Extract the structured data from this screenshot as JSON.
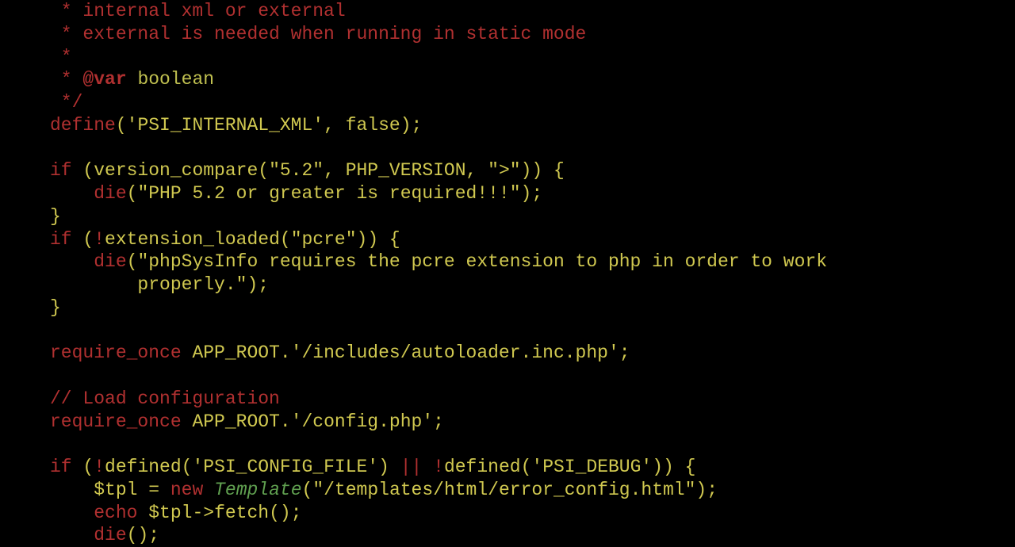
{
  "code": {
    "comment": {
      "l1": " * internal xml or external",
      "l2": " * external is needed when running in static mode",
      "l3": " *",
      "l4_prefix": " * ",
      "l4_tag": "@var",
      "l4_type": " boolean",
      "l5": " */"
    },
    "define": {
      "kw": "define",
      "openParen": "(",
      "str": "'PSI_INTERNAL_XML'",
      "comma": ", ",
      "bool": "false",
      "closeParen": ")",
      "semi": ";"
    },
    "if1": {
      "kw_if": "if",
      "open": " (",
      "fn": "version_compare",
      "openP": "(",
      "str1": "\"5.2\"",
      "c1": ", ",
      "const": "PHP_VERSION",
      "c2": ", ",
      "str2": "\">\"",
      "closeP": ")) {",
      "indent": "    ",
      "die_kw": "die",
      "die_open": "(",
      "die_str": "\"PHP 5.2 or greater is required!!!\"",
      "die_close": ");",
      "closeBrace": "}"
    },
    "if2": {
      "kw_if": "if",
      "open": " (",
      "not": "!",
      "fn": "extension_loaded",
      "openP": "(",
      "str1": "\"pcre\"",
      "closeP": ")) {",
      "indent": "    ",
      "die_kw": "die",
      "die_open": "(",
      "die_str1": "\"phpSysInfo requires the pcre extension to php in order to work",
      "die_line2_indent": "        ",
      "die_str2": "properly.\"",
      "die_close": ");",
      "closeBrace": "}"
    },
    "req1": {
      "kw": "require_once",
      "space": " ",
      "const": "APP_ROOT",
      "dot": ".",
      "str": "'/includes/autoloader.inc.php'",
      "semi": ";"
    },
    "comment2": "// Load configuration",
    "req2": {
      "kw": "require_once",
      "space": " ",
      "const": "APP_ROOT",
      "dot": ".",
      "str": "'/config.php'",
      "semi": ";"
    },
    "if3": {
      "kw_if": "if",
      "open": " (",
      "not1": "!",
      "fn1": "defined",
      "openP1": "(",
      "str1": "'PSI_CONFIG_FILE'",
      "closeP1": ") ",
      "or": "||",
      "space": " ",
      "not2": "!",
      "fn2": "defined",
      "openP2": "(",
      "str2": "'PSI_DEBUG'",
      "closeP2": ")) {",
      "indent": "    ",
      "var1": "$tpl",
      "eq": " = ",
      "new_kw": "new",
      "sp": " ",
      "class": "Template",
      "tplOpen": "(",
      "tplStr": "\"/templates/html/error_config.html\"",
      "tplClose": ");",
      "echo_kw": "echo",
      "echo_sp": " ",
      "var2": "$tpl",
      "arrow": "->",
      "method": "fetch",
      "methodCall": "();",
      "die_kw": "die",
      "die_call": "();"
    }
  }
}
